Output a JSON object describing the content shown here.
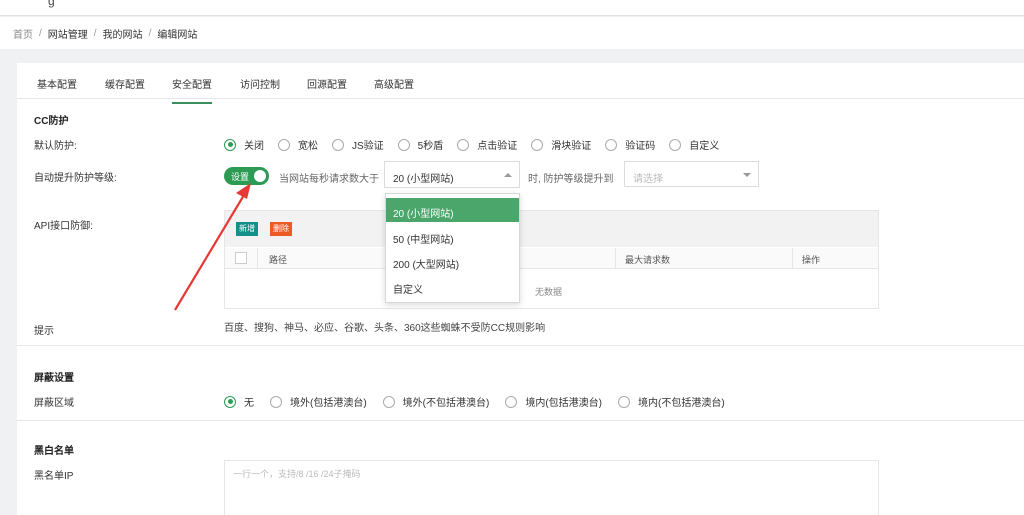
{
  "breadcrumb": [
    "首页",
    "网站管理",
    "我的网站",
    "编辑网站"
  ],
  "tabs": [
    "基本配置",
    "缓存配置",
    "安全配置",
    "访问控制",
    "回源配置",
    "高级配置"
  ],
  "active_tab": "安全配置",
  "cc": {
    "section_title": "CC防护",
    "default_label": "默认防护:",
    "options": [
      "关闭",
      "宽松",
      "JS验证",
      "5秒盾",
      "点击验证",
      "滑块验证",
      "验证码",
      "自定义"
    ],
    "selected": "关闭",
    "auto_label": "自动提升防护等级:",
    "toggle_label": "设置",
    "toggle_on": true,
    "text_before": "当网站每秒请求数大于",
    "select_value": "20 (小型网站)",
    "text_after": "时, 防护等级提升到",
    "level_placeholder": "请选择"
  },
  "dropdown": {
    "options": [
      "20 (小型网站)",
      "50 (中型网站)",
      "200 (大型网站)",
      "自定义"
    ],
    "selected": "20 (小型网站)"
  },
  "api": {
    "label": "API接口防御:",
    "add_label": "新增",
    "delete_label": "删除",
    "columns": [
      "路径",
      "最大请求数",
      "操作"
    ],
    "empty_text": "无数据"
  },
  "tip": {
    "label": "提示",
    "text": "百度、搜狗、神马、必应、谷歌、头条、360这些蜘蛛不受防CC规则影响"
  },
  "shield": {
    "section_title": "屏蔽设置",
    "region_label": "屏蔽区域",
    "options": [
      "无",
      "境外(包括港澳台)",
      "境外(不包括港澳台)",
      "境内(包括港澳台)",
      "境内(不包括港澳台)"
    ],
    "selected": "无"
  },
  "blacklist": {
    "section_title": "黑白名单",
    "ip_label": "黑名单IP",
    "placeholder": "一行一个，支持/8 /16 /24子掩码"
  },
  "colors": {
    "accent": "#2e9b55",
    "highlight": "#4aa66a",
    "add_button": "#14908a",
    "delete_button": "#ee5a24",
    "annotation_arrow": "#e53935"
  },
  "icons": {
    "menu": "menu-icon",
    "caret": "chevron-down-icon",
    "annotation": "red-arrow-icon"
  }
}
